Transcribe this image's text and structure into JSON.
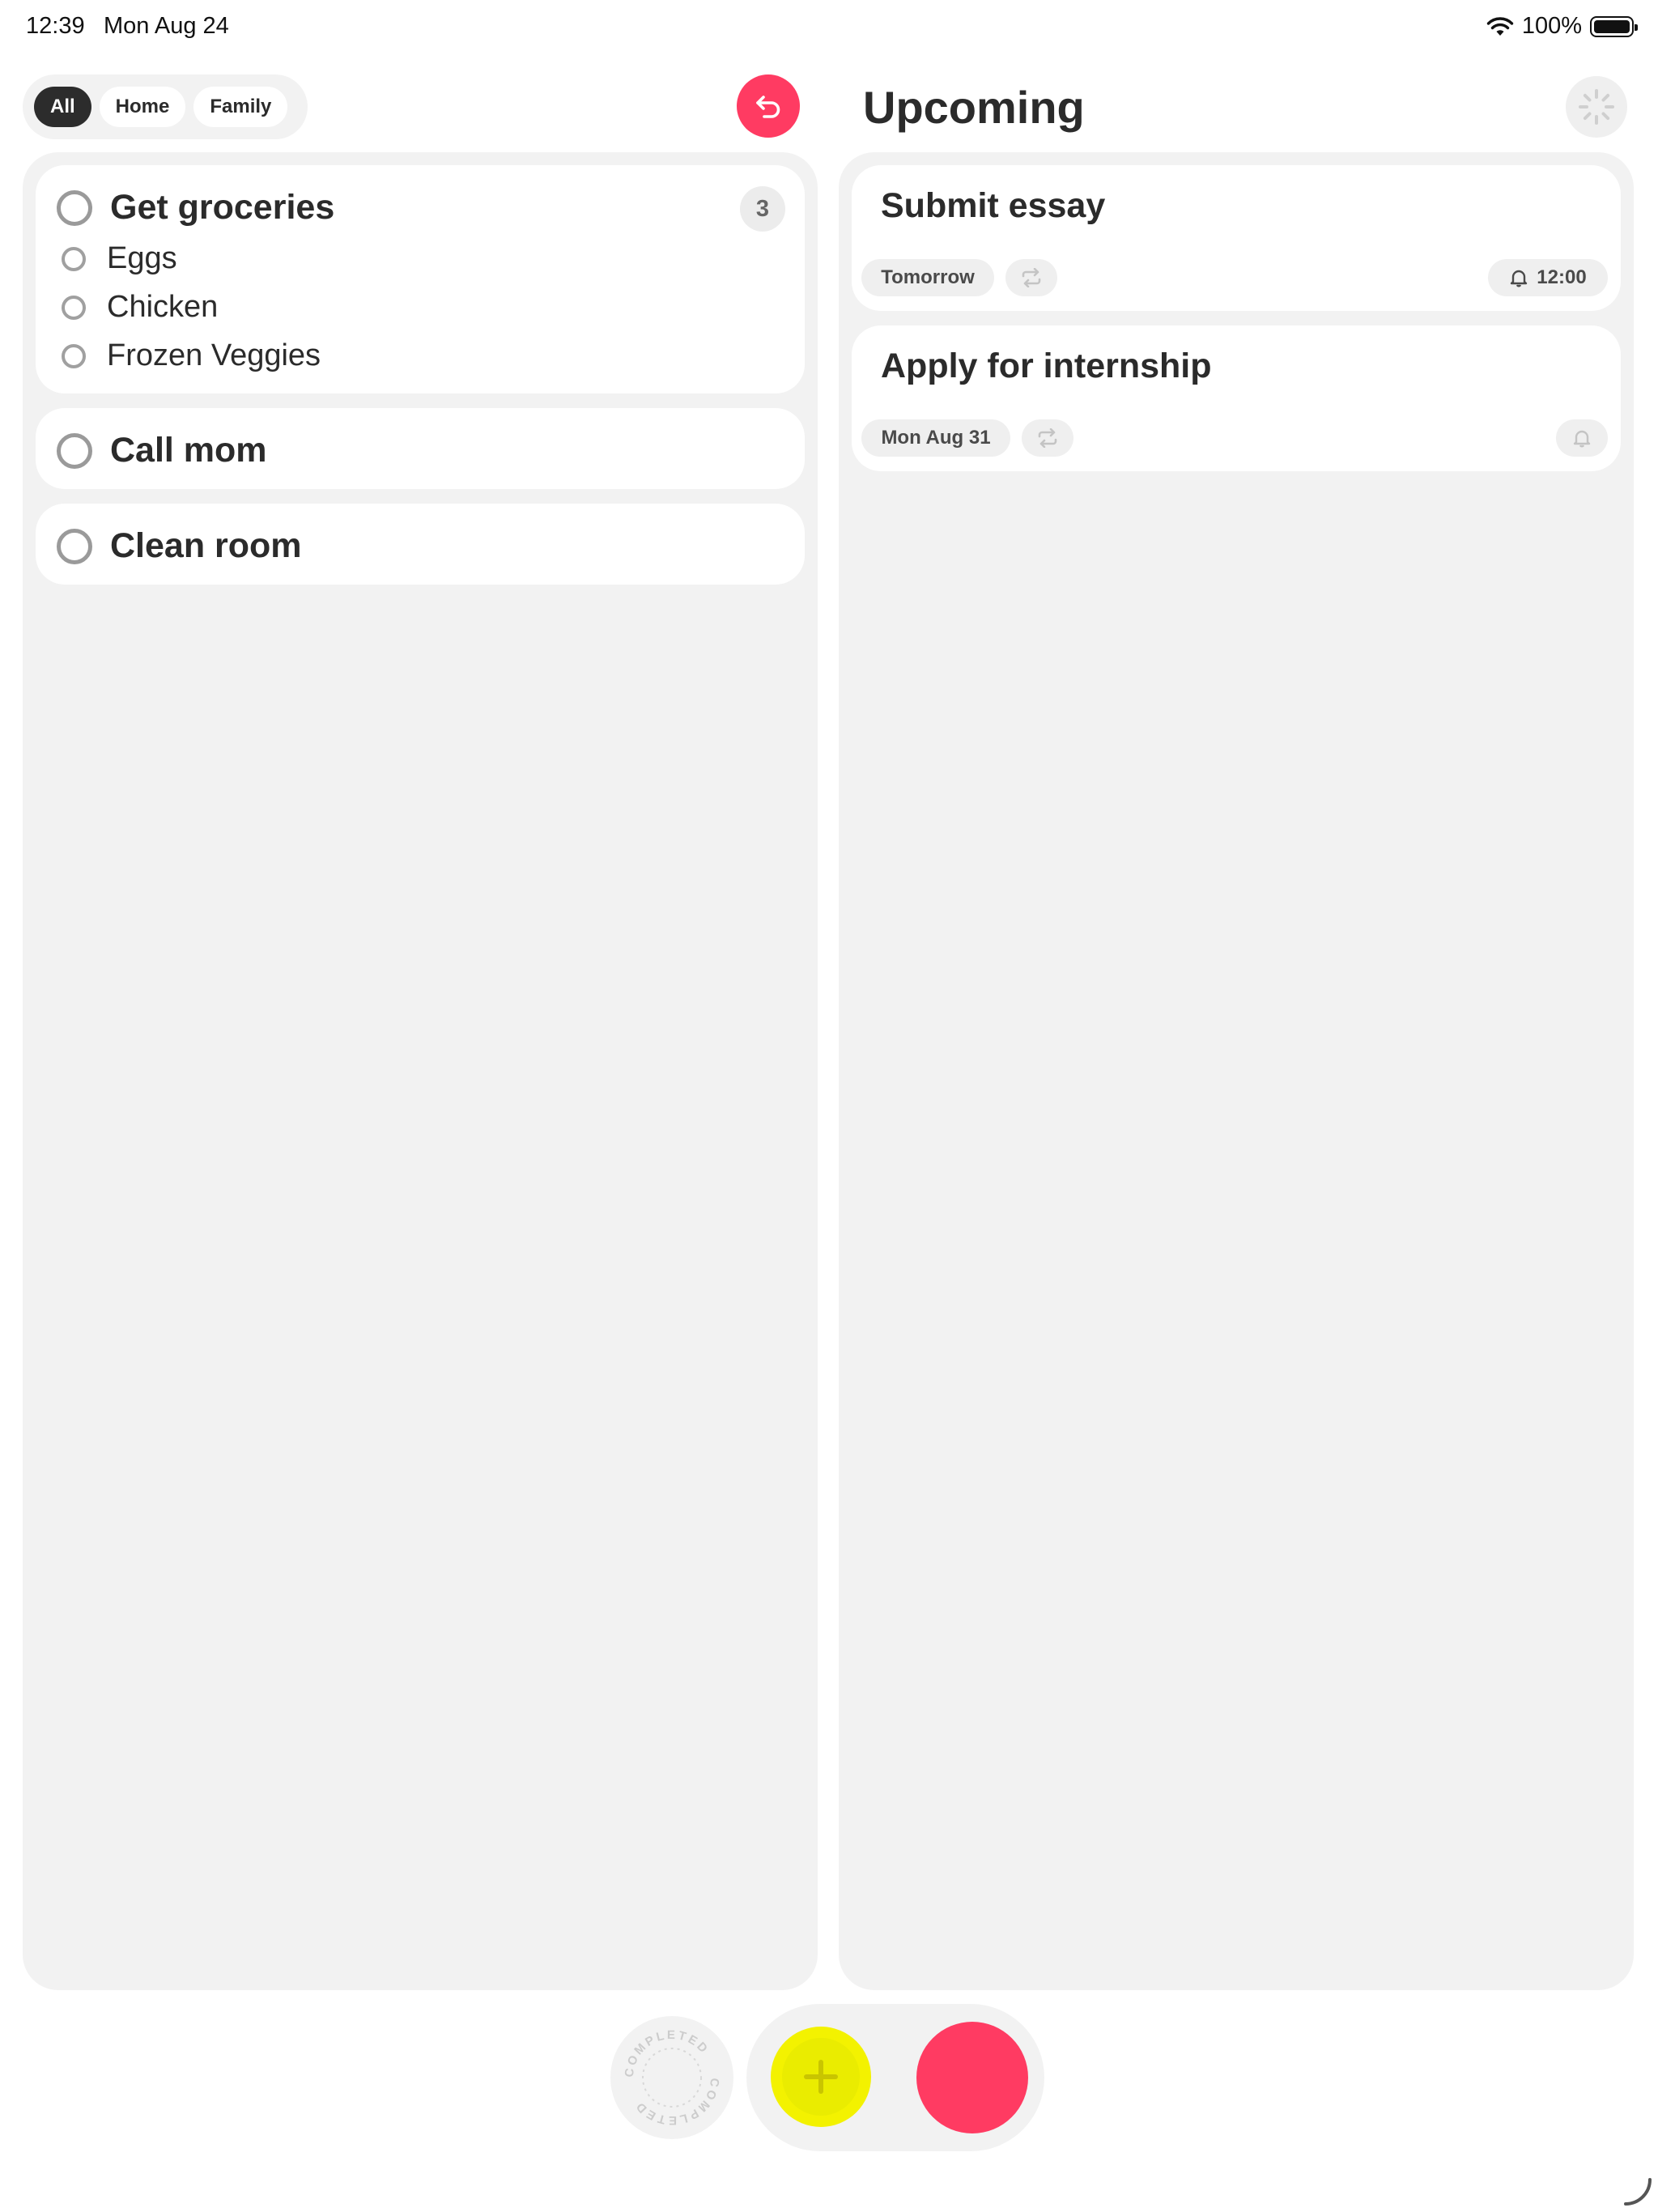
{
  "status_bar": {
    "time": "12:39",
    "date": "Mon Aug 24",
    "battery_percent": "100%"
  },
  "filters": {
    "tabs": [
      {
        "label": "All",
        "active": true
      },
      {
        "label": "Home",
        "active": false
      },
      {
        "label": "Family",
        "active": false
      }
    ]
  },
  "inbox": {
    "tasks": [
      {
        "title": "Get groceries",
        "count": "3",
        "subtasks": [
          "Eggs",
          "Chicken",
          "Frozen Veggies"
        ]
      },
      {
        "title": "Call mom"
      },
      {
        "title": "Clean room"
      }
    ]
  },
  "upcoming": {
    "title": "Upcoming",
    "items": [
      {
        "title": "Submit essay",
        "date": "Tomorrow",
        "reminder": "12:00"
      },
      {
        "title": "Apply for internship",
        "date": "Mon Aug 31",
        "reminder": ""
      }
    ]
  },
  "dock": {
    "completed_label": "COMPLETED"
  },
  "colors": {
    "accent_pink": "#ff3b62",
    "accent_yellow": "#f3f200",
    "panel_bg": "#f2f2f2"
  }
}
